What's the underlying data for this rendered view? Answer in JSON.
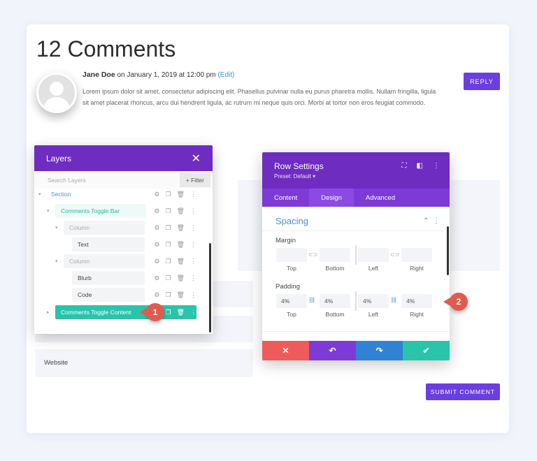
{
  "page": {
    "title": "12 Comments"
  },
  "comment": {
    "author": "Jane Doe",
    "meta": "on January 1, 2019 at 12:00 pm",
    "edit_label": "(Edit)",
    "body": "Lorem ipsum dolor sit amet, consectetur adipiscing elit. Phasellus pulvinar nulla eu purus pharetra mollis. Nullam fringilla, ligula sit amet placerat rhoncus, arcu dui hendrerit ligula, ac rutrum mi neque quis orci. Morbi at tortor non eros feugiat commodo.",
    "reply_label": "REPLY"
  },
  "form": {
    "website_label": "Website",
    "submit_label": "SUBMIT COMMENT"
  },
  "layers_panel": {
    "title": "Layers",
    "search_placeholder": "Search Layers",
    "filter_label": "+ Filter",
    "rows": [
      {
        "label": "Section"
      },
      {
        "label": "Comments Toggle Bar"
      },
      {
        "label": "Column"
      },
      {
        "label": "Text"
      },
      {
        "label": "Column"
      },
      {
        "label": "Blurb"
      },
      {
        "label": "Code"
      },
      {
        "label": "Comments Toggle Content"
      }
    ]
  },
  "row_settings": {
    "title": "Row Settings",
    "preset": "Preset: Default ▾",
    "tabs": [
      "Content",
      "Design",
      "Advanced"
    ],
    "active_tab": "Design",
    "spacing_title": "Spacing",
    "margin_label": "Margin",
    "padding_label": "Padding",
    "side_labels": [
      "Top",
      "Bottom",
      "Left",
      "Right"
    ],
    "padding_values": [
      "4%",
      "4%",
      "4%",
      "4%"
    ]
  },
  "callouts": [
    "1",
    "2"
  ],
  "colors": {
    "purple": "#6e2cc1",
    "accent_blue": "#4a8fd6",
    "teal": "#29c4a9",
    "cancel_red": "#ef5a5a",
    "undo_purple": "#7d3ad7",
    "redo_blue": "#2f82d4",
    "save_teal": "#29c4a9",
    "callout_red": "#e05a4e"
  }
}
